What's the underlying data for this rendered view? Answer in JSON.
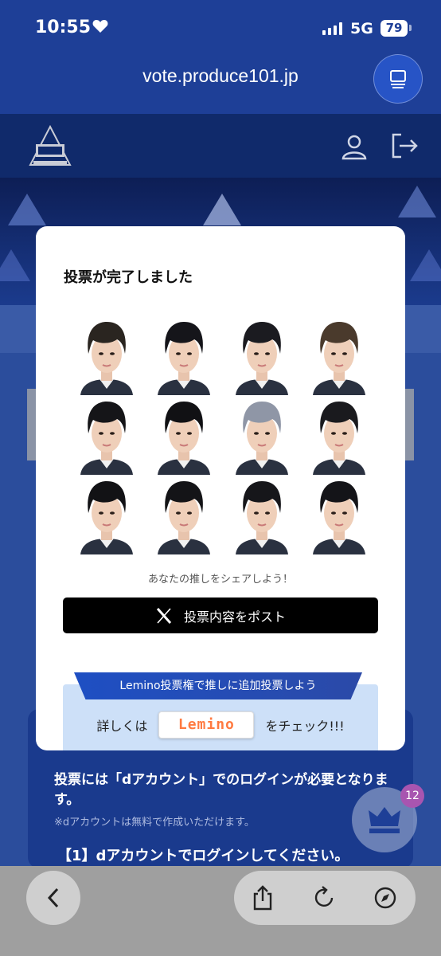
{
  "status": {
    "time": "10:55",
    "network": "5G",
    "battery": "79"
  },
  "browser": {
    "url": "vote.produce101.jp"
  },
  "header": {
    "logo_alt": "PRODUCE 101 JAPAN SHINSEKAI"
  },
  "modal": {
    "title": "投票が完了しました",
    "share_caption": "あなたの推しをシェアしよう！",
    "post_button": "投票内容をポスト",
    "lemino_banner": "Lemino投票権で推しに追加投票しよう",
    "lemino_prefix": "詳しくは",
    "lemino_logo": "Lemino",
    "lemino_suffix": "をチェック!!!",
    "trainees": [
      {
        "hair": "#2a2520"
      },
      {
        "hair": "#15151a"
      },
      {
        "hair": "#1b1b20"
      },
      {
        "hair": "#4a3a2c"
      },
      {
        "hair": "#151518"
      },
      {
        "hair": "#111114"
      },
      {
        "hair": "#8f96a6"
      },
      {
        "hair": "#1a1a1e"
      },
      {
        "hair": "#121215"
      },
      {
        "hair": "#141417"
      },
      {
        "hair": "#16161a"
      },
      {
        "hair": "#141418"
      }
    ]
  },
  "page": {
    "login_notice": "投票には「dアカウント」でのログインが必要となります。",
    "login_note": "※dアカウントは無料で作成いただけます。",
    "step1": "【1】dアカウントでログインしてください。",
    "fab_badge": "12"
  },
  "colors": {
    "brand_blue": "#1e3f97",
    "header_navy": "#102a6b",
    "badge_purple": "#a855b0"
  }
}
